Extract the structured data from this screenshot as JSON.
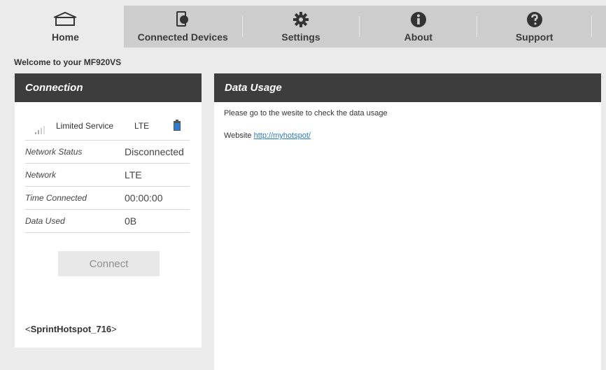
{
  "nav": {
    "home": "Home",
    "devices": "Connected Devices",
    "settings": "Settings",
    "about": "About",
    "support": "Support"
  },
  "welcome": "Welcome to your MF920VS",
  "connection": {
    "title": "Connection",
    "status": "Limited Service",
    "tech": "LTE",
    "rows": [
      {
        "label": "Network Status",
        "value": "Disconnected"
      },
      {
        "label": "Network",
        "value": "LTE"
      },
      {
        "label": "Time Connected",
        "value": "00:00:00"
      },
      {
        "label": "Data Used",
        "value": "0B"
      }
    ],
    "connect_label": "Connect",
    "ssid_open": "<",
    "ssid": "SprintHotspot_716",
    "ssid_close": ">"
  },
  "data_usage": {
    "title": "Data Usage",
    "message": "Please go to the wesite to check the data usage",
    "website_label": "Website",
    "website_link": "http://myhotspot/"
  },
  "colors": {
    "header_bg": "#3d3d3d",
    "nav_bg": "#cdcdcd",
    "link": "#2a7ac9",
    "battery": "#2f7fd1"
  }
}
